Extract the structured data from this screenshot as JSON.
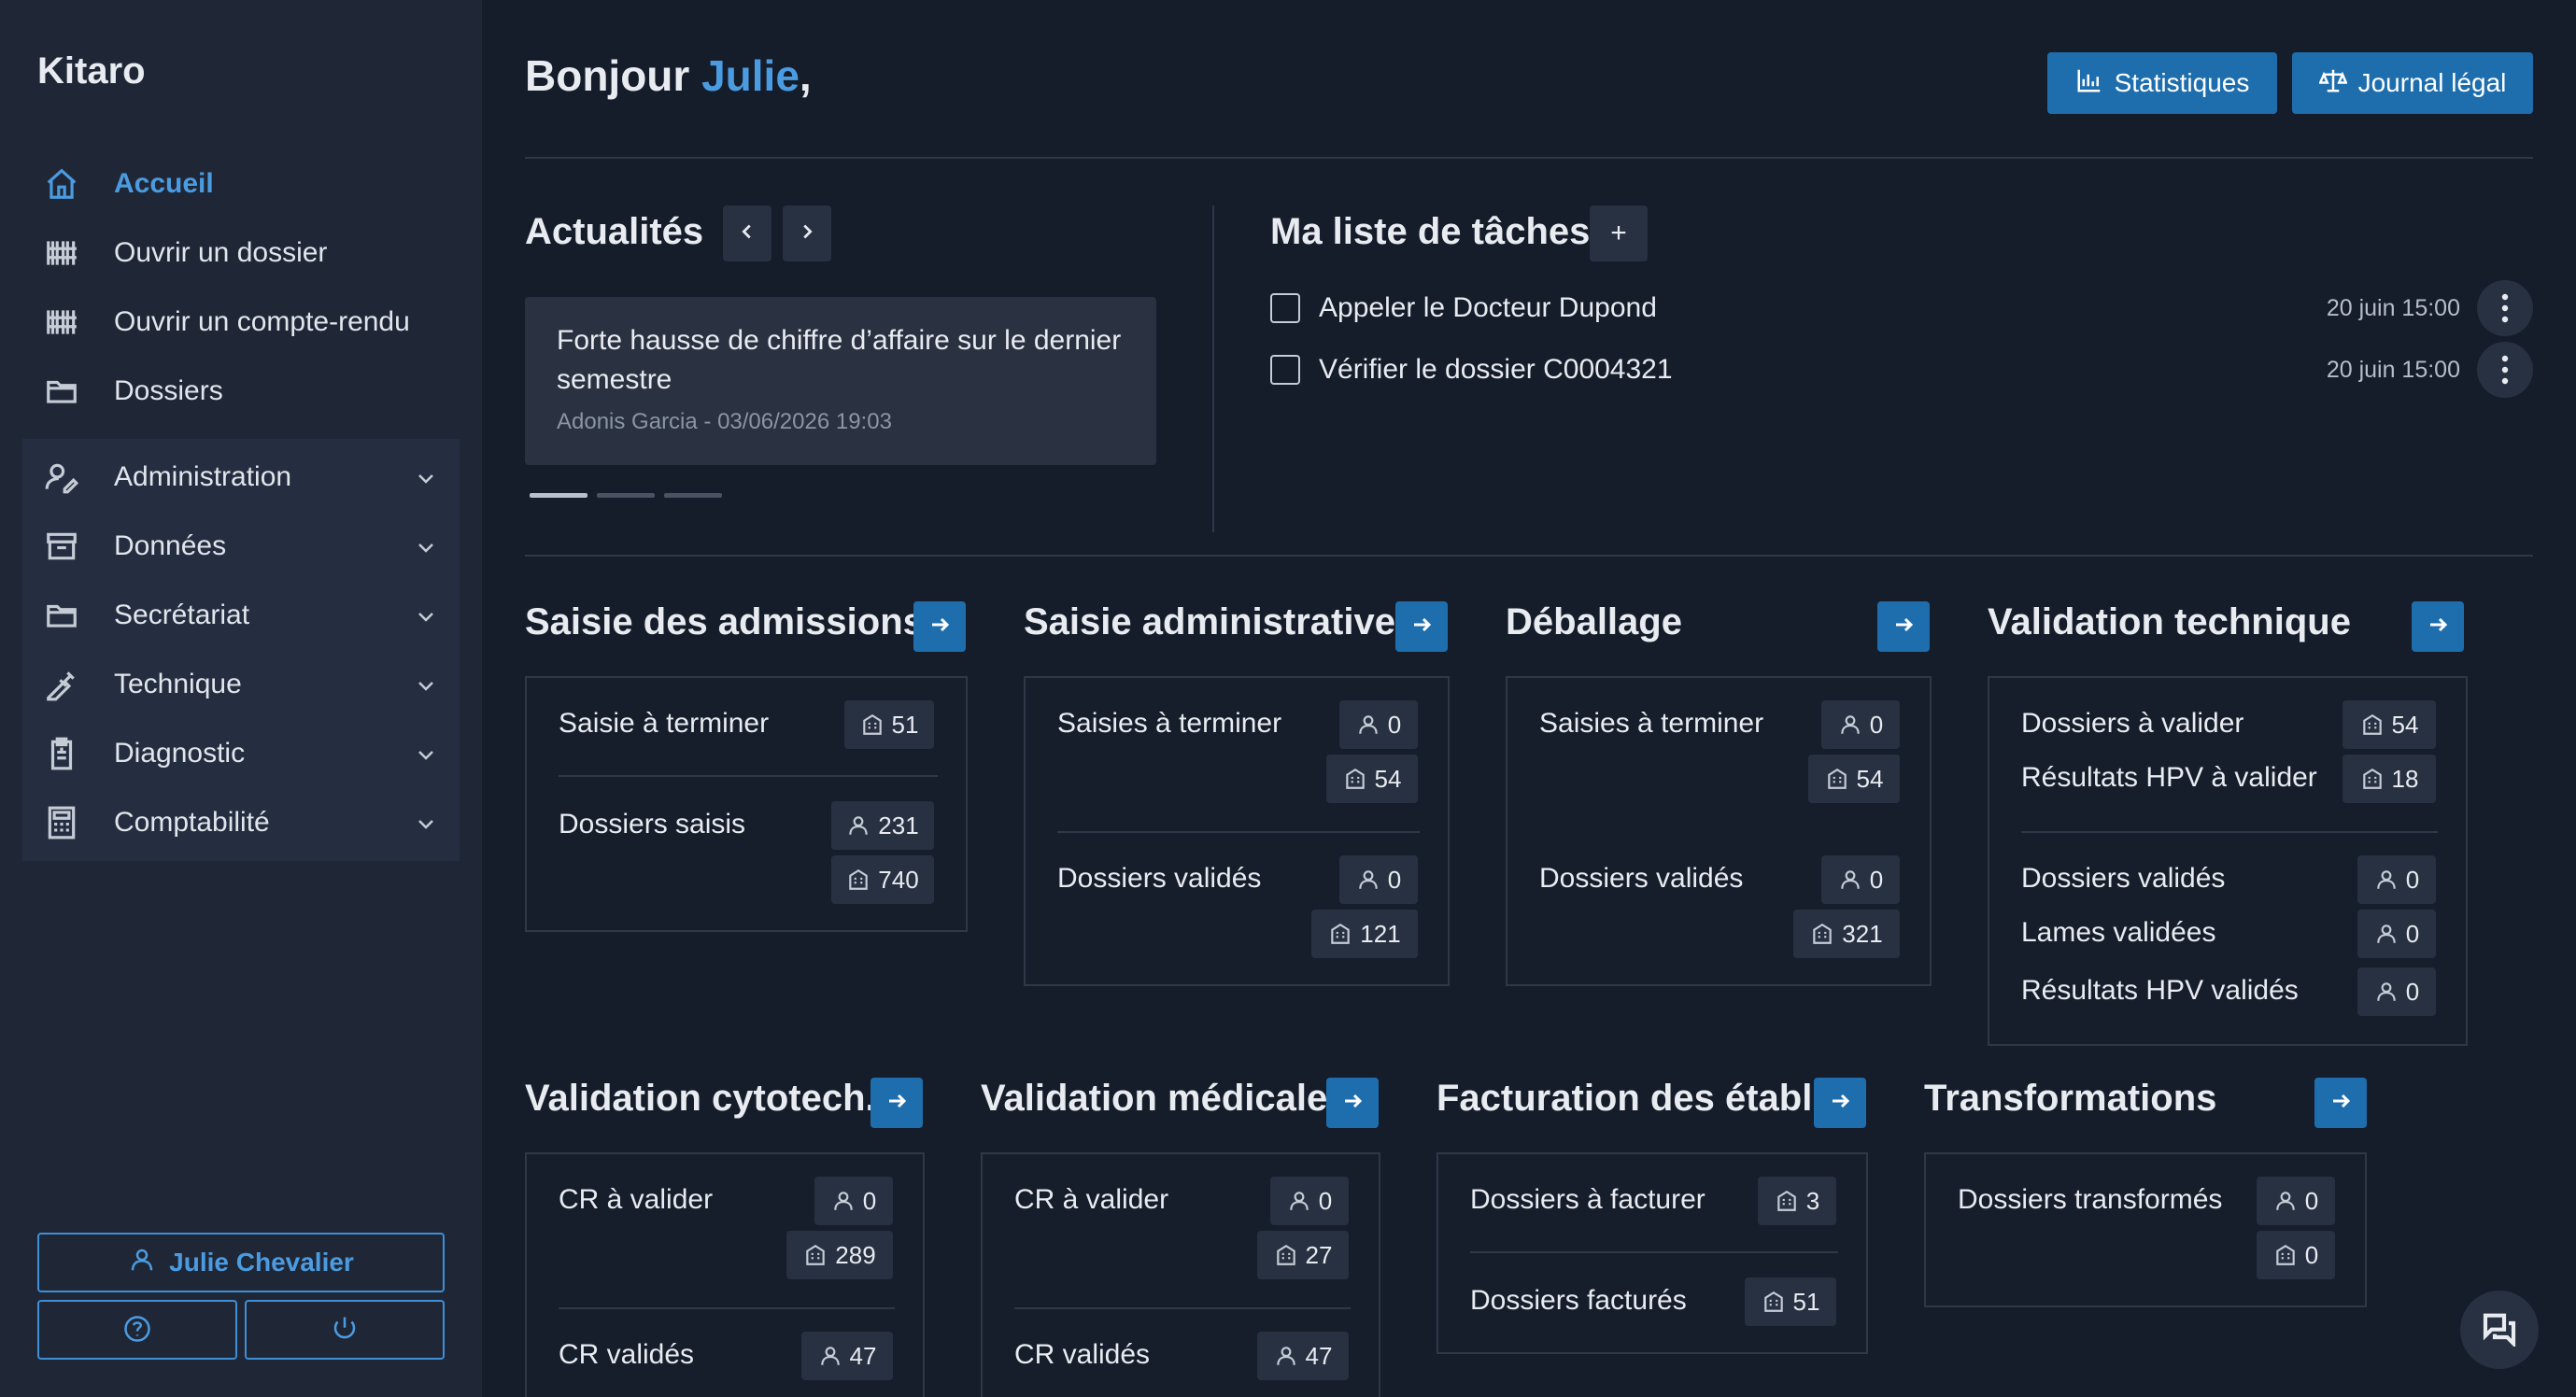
{
  "app": {
    "brand": "Kitaro"
  },
  "sidebar": {
    "items": [
      {
        "label": "Accueil",
        "icon": "home-icon"
      },
      {
        "label": "Ouvrir un dossier",
        "icon": "barcode-icon"
      },
      {
        "label": "Ouvrir un compte-rendu",
        "icon": "barcode-icon"
      },
      {
        "label": "Dossiers",
        "icon": "folder-icon"
      }
    ],
    "groups": [
      {
        "label": "Administration",
        "icon": "user-edit-icon"
      },
      {
        "label": "Données",
        "icon": "archive-icon"
      },
      {
        "label": "Secrétariat",
        "icon": "folder-icon"
      },
      {
        "label": "Technique",
        "icon": "pipette-icon"
      },
      {
        "label": "Diagnostic",
        "icon": "clipboard-icon"
      },
      {
        "label": "Comptabilité",
        "icon": "calculator-icon"
      }
    ],
    "user": "Julie Chevalier"
  },
  "header": {
    "greeting": "Bonjour ",
    "name": "Julie",
    "punct": ",",
    "stats_label": "Statistiques",
    "journal_label": "Journal légal"
  },
  "news": {
    "title": "Actualités",
    "headline": "Forte hausse de chiffre d’affaire sur le dernier semestre",
    "meta": "Adonis Garcia - 03/06/2026 19:03"
  },
  "tasks": {
    "title": "Ma liste de tâches",
    "add": "+",
    "items": [
      {
        "label": "Appeler le Docteur Dupond",
        "time": "20 juin 15:00"
      },
      {
        "label": "Vérifier le dossier C0004321",
        "time": "20 juin 15:00"
      }
    ]
  },
  "cards": {
    "admissions": {
      "title": "Saisie des admissions",
      "r1": "Saisie à terminer",
      "r1b": "51",
      "r2": "Dossiers saisis",
      "r2a": "231",
      "r2b": "740"
    },
    "administrative": {
      "title": "Saisie administrative",
      "r1": "Saisies à terminer",
      "r1a": "0",
      "r1b": "54",
      "r2": "Dossiers validés",
      "r2a": "0",
      "r2b": "121"
    },
    "deballage": {
      "title": "Déballage",
      "r1": "Saisies à terminer",
      "r1a": "0",
      "r1b": "54",
      "r2": "Dossiers validés",
      "r2a": "0",
      "r2b": "321"
    },
    "technique": {
      "title": "Validation technique",
      "r1": "Dossiers à valider",
      "r1b": "54",
      "r2": "Résultats HPV à valider",
      "r2b": "18",
      "r3": "Dossiers validés",
      "r3a": "0",
      "r4": "Lames validées",
      "r4a": "0",
      "r5": "Résultats HPV validés",
      "r5a": "0"
    },
    "cytotech": {
      "title": "Validation cytotech.",
      "r1": "CR à valider",
      "r1a": "0",
      "r1b": "289",
      "r2": "CR validés",
      "r2a": "47"
    },
    "medicale": {
      "title": "Validation médicale",
      "r1": "CR à valider",
      "r1a": "0",
      "r1b": "27",
      "r2": "CR validés",
      "r2a": "47"
    },
    "facturation": {
      "title": "Facturation des établ.",
      "r1": "Dossiers à facturer",
      "r1b": "3",
      "r2": "Dossiers facturés",
      "r2b": "51"
    },
    "transformations": {
      "title": "Transformations",
      "r1": "Dossiers transformés",
      "r1a": "0",
      "r1b": "0"
    }
  },
  "colors": {
    "accent": "#4b9be0",
    "button": "#1e6eae",
    "bg": "#151c2a",
    "sidebar": "#1f2737"
  }
}
